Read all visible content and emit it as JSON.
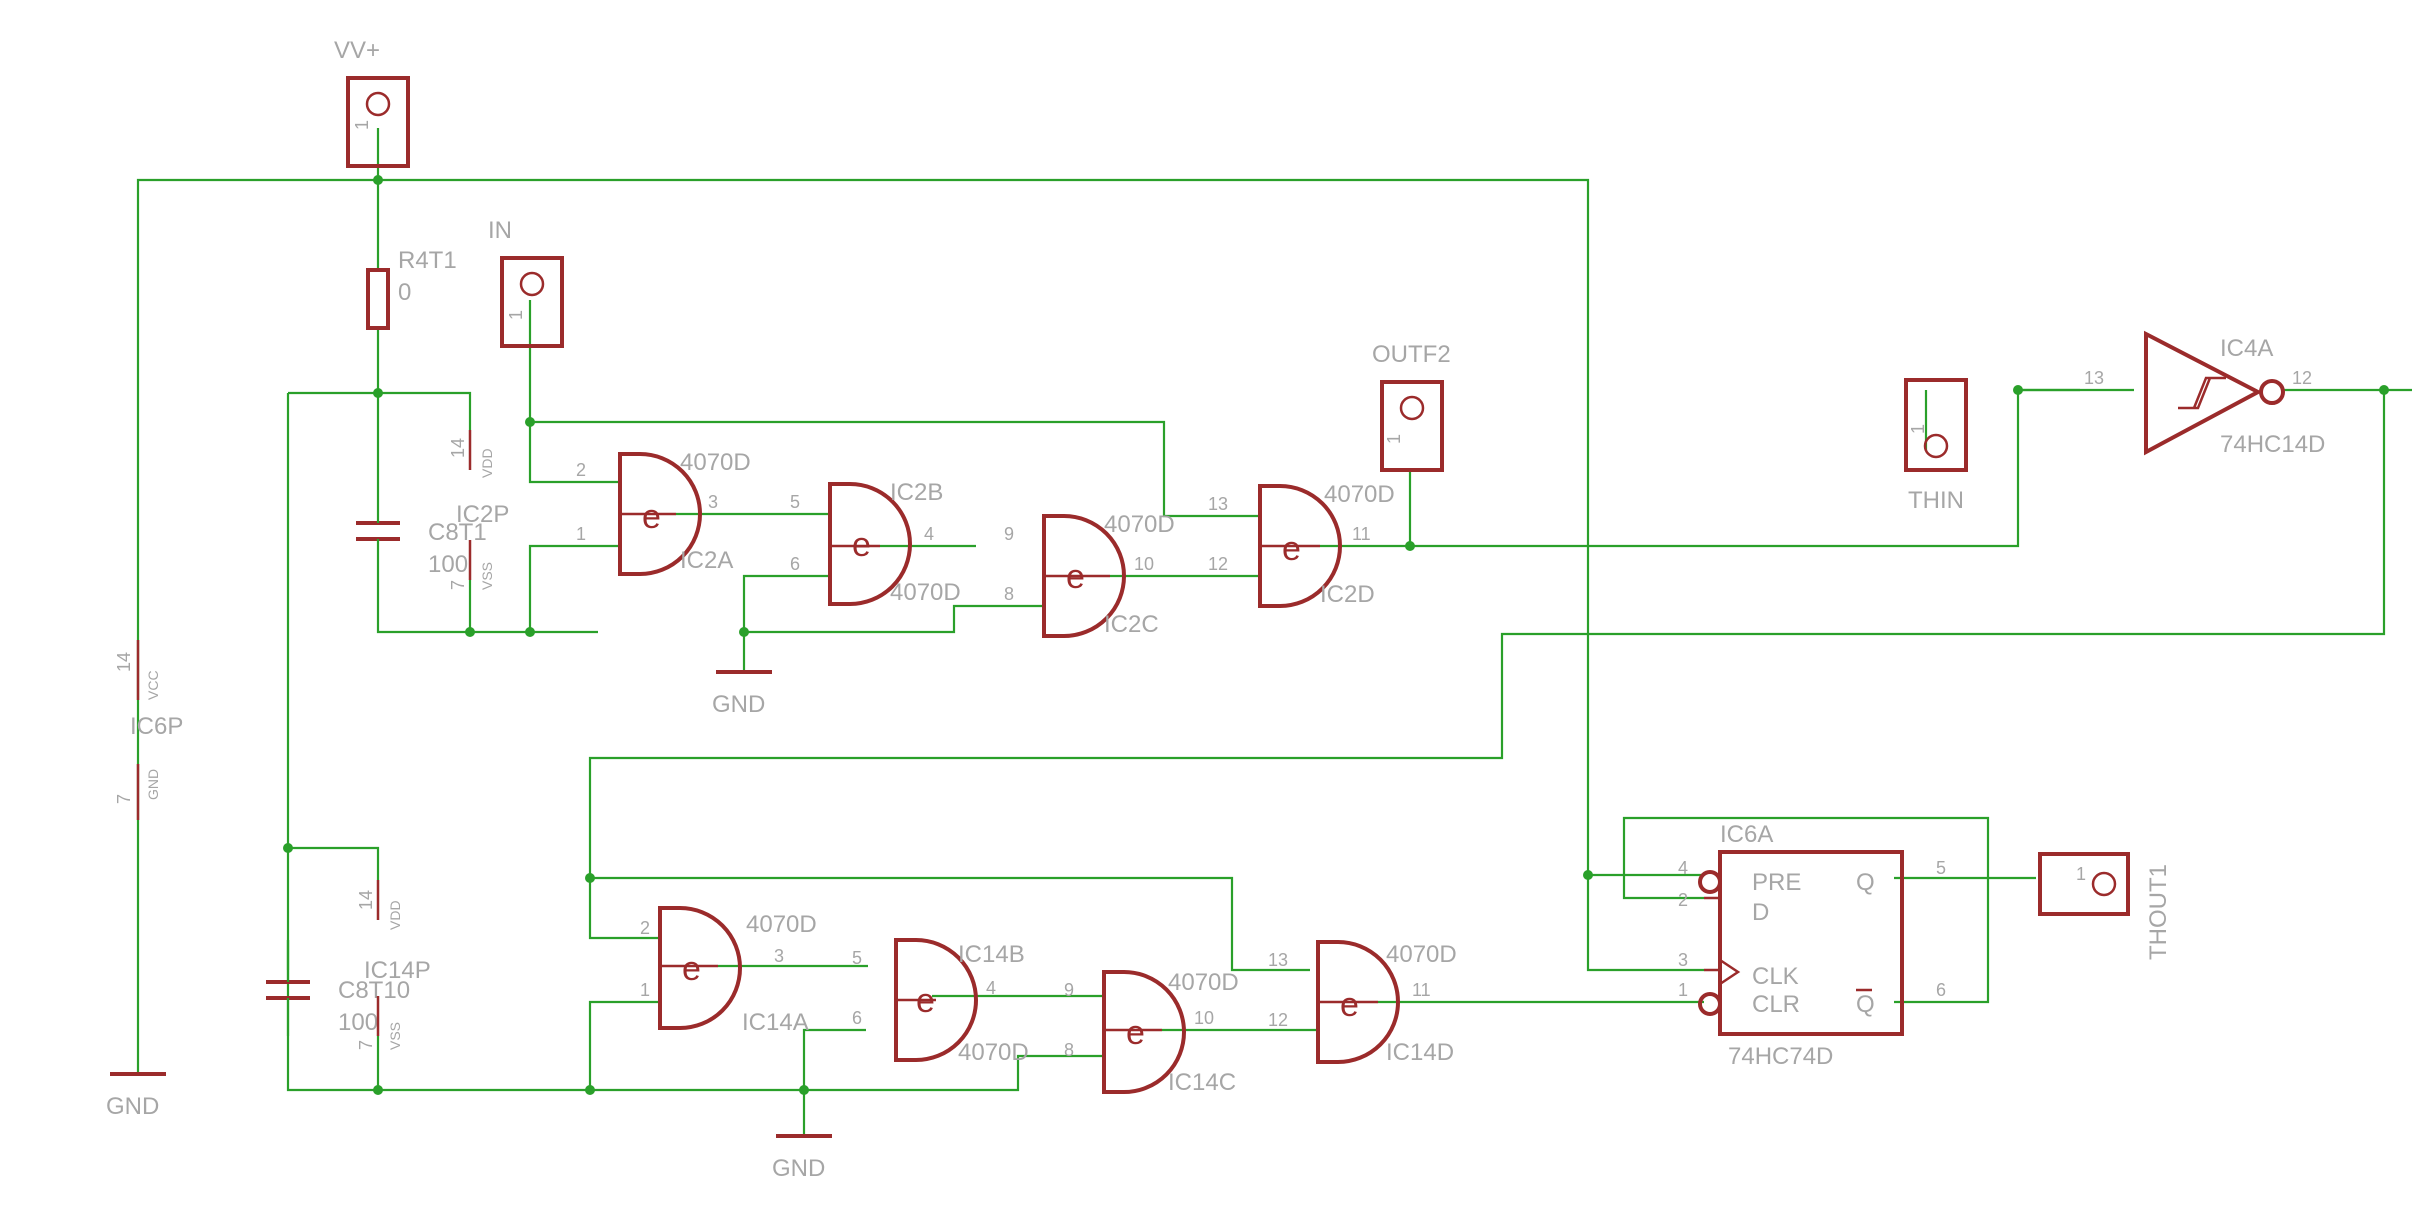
{
  "supply": {
    "vcc_label": "VV+",
    "gnd_label": "GND",
    "pin1": "1"
  },
  "connectors": {
    "in": "IN",
    "outf2": "OUTF2",
    "thin": "THIN",
    "thout1": "THOUT1"
  },
  "resistor": {
    "name": "R4T1",
    "value": "0"
  },
  "caps": {
    "c1": {
      "name": "C8T1",
      "value": "100"
    },
    "c2": {
      "name": "C8T10",
      "value": "100"
    }
  },
  "power_parts": {
    "ic2p": "IC2P",
    "ic14p": "IC14P",
    "ic6p": "IC6P",
    "vdd": "VDD",
    "vss": "VSS",
    "vcc": "VCC",
    "gnd": "GND",
    "p14": "14",
    "p7": "7"
  },
  "gate_symbol": "e",
  "gate_type": "4070D",
  "gates": {
    "ic2a": "IC2A",
    "ic2b": "IC2B",
    "ic2c": "IC2C",
    "ic2d": "IC2D",
    "ic14a": "IC14A",
    "ic14b": "IC14B",
    "ic14c": "IC14C",
    "ic14d": "IC14D"
  },
  "pins": {
    "p1": "1",
    "p2": "2",
    "p3": "3",
    "p4": "4",
    "p5": "5",
    "p6": "6",
    "p8": "8",
    "p9": "9",
    "p10": "10",
    "p11": "11",
    "p12": "12",
    "p13": "13"
  },
  "schmitt": {
    "name": "IC4A",
    "type": "74HC14D",
    "in_pin": "13",
    "out_pin": "12"
  },
  "flipflop": {
    "name": "IC6A",
    "type": "74HC74D",
    "pre": "PRE",
    "d": "D",
    "clk": "CLK",
    "clr": "CLR",
    "q": "Q",
    "qbar": "Q",
    "pin_pre": "4",
    "pin_d": "2",
    "pin_clk": "3",
    "pin_clr": "1",
    "pin_q": "5",
    "pin_qbar": "6"
  }
}
